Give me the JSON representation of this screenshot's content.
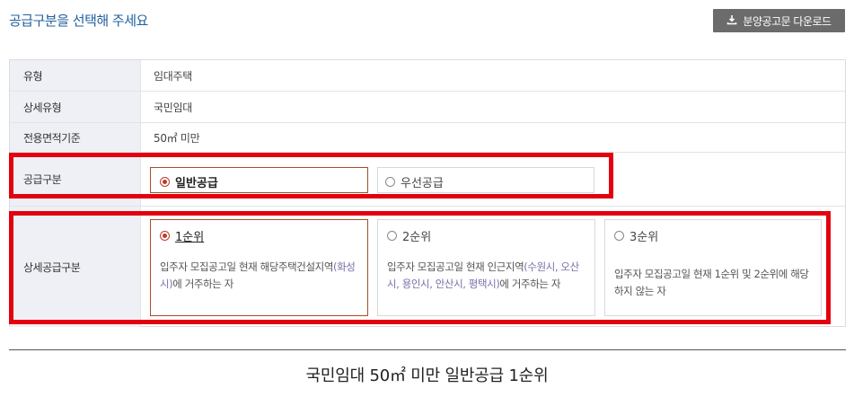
{
  "header": {
    "title": "공급구분을 선택해 주세요",
    "download_label": "분양공고문 다운로드"
  },
  "form": {
    "rows": [
      {
        "label": "유형",
        "value": "임대주택"
      },
      {
        "label": "상세유형",
        "value": "국민임대"
      },
      {
        "label": "전용면적기준",
        "value": "50㎡ 미만"
      }
    ],
    "supply": {
      "label": "공급구분",
      "options": [
        {
          "label": "일반공급",
          "selected": true
        },
        {
          "label": "우선공급",
          "selected": false
        }
      ]
    },
    "detail": {
      "label": "상세공급구분",
      "options": [
        {
          "label": "1순위",
          "selected": true,
          "desc_a": "입주자 모집공고일 현재 해당주택건설지역",
          "desc_hl": "(화성시)",
          "desc_b": "에 거주하는 자"
        },
        {
          "label": "2순위",
          "selected": false,
          "desc_a": "입주자 모집공고일 현재 인근지역",
          "desc_hl": "(수원시, 오산시, 용인시, 안산시, 평택시)",
          "desc_b": "에 거주하는 자"
        },
        {
          "label": "3순위",
          "selected": false,
          "desc_a": "입주자 모집공고일 현재 1순위 및 2순위에 해당하지 않는 자",
          "desc_hl": "",
          "desc_b": ""
        }
      ]
    }
  },
  "summary": "국민임대 50㎡ 미만 일반공급 1순위",
  "colors": {
    "title": "#1f5f9e",
    "highlight_frame": "#e3000f",
    "selected_border": "#a84d2a",
    "radio_on": "#c0392b",
    "region_text": "#7b6fa8",
    "button_bg": "#6b6b6b"
  },
  "icons": {
    "download": "download-icon",
    "radio_on": "radio-selected-icon",
    "radio_off": "radio-unselected-icon"
  }
}
